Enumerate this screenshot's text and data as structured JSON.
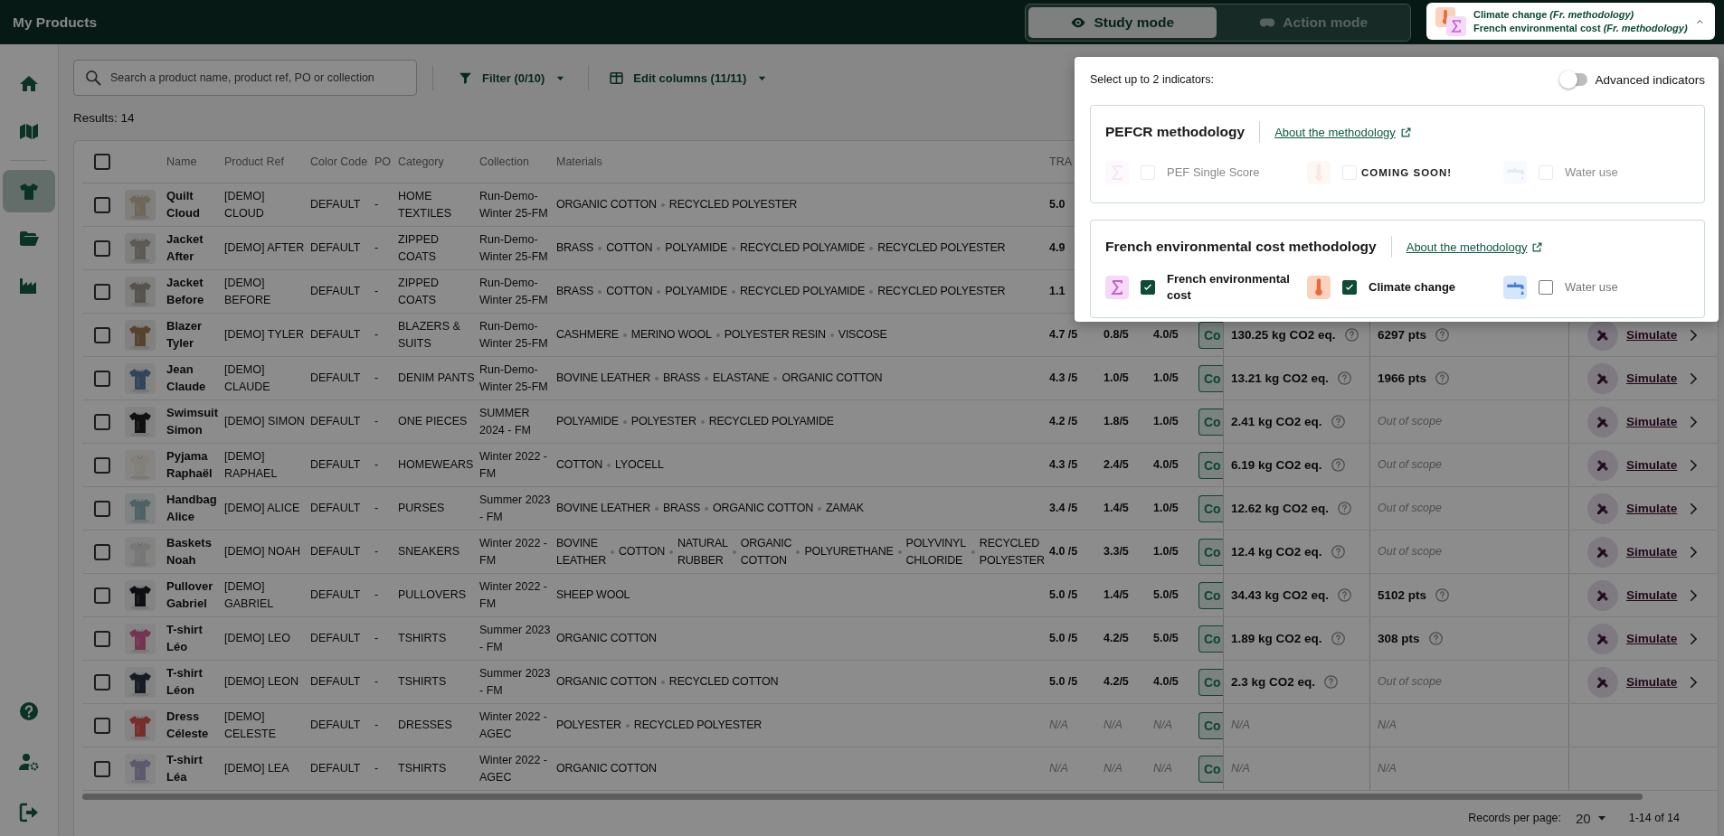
{
  "header": {
    "title": "My Products",
    "modes": [
      {
        "label": "Study mode",
        "selected": true
      },
      {
        "label": "Action mode",
        "selected": false
      }
    ]
  },
  "indicator_selector": {
    "expanded": true,
    "lines": [
      {
        "kind": "climate",
        "text": "Climate change *(Fr. methodology)*"
      },
      {
        "kind": "cost",
        "text": "French environmental cost *(Fr. methodology)*"
      }
    ]
  },
  "sidebar": {
    "items": [
      {
        "selected": false
      },
      {
        "selected": false
      },
      {
        "selected": true
      },
      {
        "selected": false
      },
      {
        "selected": false
      }
    ]
  },
  "toolbar": {
    "search": {
      "placeholder": "Search a product name, product ref, PO or collection"
    },
    "filter": "Filter (0/10)",
    "columns": "Edit columns (11/11)"
  },
  "results": "Results: 14",
  "table": {
    "header_checked": false,
    "columns": [
      "Name",
      "Product Ref",
      "Color Code",
      "PO",
      "Category",
      "Collection",
      "Materials",
      "TRA"
    ],
    "rows": [
      {
        "checked": false,
        "thumbnail": {
          "kind": "picture"
        },
        "name": "Quilt Cloud",
        "ref": "[DEMO] CLOUD",
        "color_code": "DEFAULT",
        "po": "-",
        "category": "HOME TEXTILES",
        "collection": "Run-Demo-Winter 25-FM",
        "materials": [
          "ORGANIC COTTON",
          "RECYCLED POLYESTER"
        ],
        "scores": [
          {
            "text": "5.0",
            "kind": "value"
          }
        ]
      },
      {
        "checked": false,
        "thumbnail": {
          "kind": "picture"
        },
        "name": "Jacket After",
        "ref": "[DEMO] AFTER",
        "color_code": "DEFAULT",
        "po": "-",
        "category": "ZIPPED COATS",
        "collection": "Run-Demo-Winter 25-FM",
        "materials": [
          "BRASS",
          "COTTON",
          "POLYAMIDE",
          "RECYCLED POLYAMIDE",
          "RECYCLED POLYESTER"
        ],
        "scores": [
          {
            "text": "4.9",
            "kind": "value"
          }
        ]
      },
      {
        "checked": false,
        "thumbnail": {
          "kind": "picture"
        },
        "name": "Jacket Before",
        "ref": "[DEMO] BEFORE",
        "color_code": "DEFAULT",
        "po": "-",
        "category": "ZIPPED COATS",
        "collection": "Run-Demo-Winter 25-FM",
        "materials": [
          "BRASS",
          "COTTON",
          "POLYAMIDE",
          "RECYCLED POLYAMIDE",
          "RECYCLED POLYESTER"
        ],
        "scores": [
          {
            "text": "1.1",
            "kind": "value"
          }
        ]
      },
      {
        "checked": false,
        "thumbnail": {
          "kind": "picture"
        },
        "name": "Blazer Tyler",
        "ref": "[DEMO] TYLER",
        "color_code": "DEFAULT",
        "po": "-",
        "category": "BLAZERS & SUITS",
        "collection": "Run-Demo-Winter 25-FM",
        "materials": [
          "CASHMERE",
          "MERINO WOOL",
          "POLYESTER RESIN",
          "VISCOSE"
        ],
        "scores": [
          {
            "text": "4.7 /5",
            "kind": "value"
          },
          {
            "text": "0.8/5",
            "kind": "value"
          },
          {
            "text": "4.0/5",
            "kind": "value"
          }
        ],
        "compare": "Co",
        "co2": {
          "text": "130.25 kg CO2 eq.",
          "kind": "value"
        },
        "points": {
          "text": "6297 pts",
          "kind": "value"
        },
        "action": "Simulate"
      },
      {
        "checked": false,
        "thumbnail": {
          "kind": "picture"
        },
        "name": "Jean Claude",
        "ref": "[DEMO] CLAUDE",
        "color_code": "DEFAULT",
        "po": "-",
        "category": "DENIM PANTS",
        "collection": "Run-Demo-Winter 25-FM",
        "materials": [
          "BOVINE LEATHER",
          "BRASS",
          "ELASTANE",
          "ORGANIC COTTON"
        ],
        "scores": [
          {
            "text": "4.3 /5",
            "kind": "value"
          },
          {
            "text": "1.0/5",
            "kind": "value"
          },
          {
            "text": "1.0/5",
            "kind": "value"
          }
        ],
        "compare": "Co",
        "co2": {
          "text": "13.21 kg CO2 eq.",
          "kind": "value"
        },
        "points": {
          "text": "1966 pts",
          "kind": "value"
        },
        "action": "Simulate"
      },
      {
        "checked": false,
        "thumbnail": {
          "kind": "picture"
        },
        "name": "Swimsuit Simon",
        "ref": "[DEMO] SIMON",
        "color_code": "DEFAULT",
        "po": "-",
        "category": "ONE PIECES",
        "collection": "SUMMER 2024 - FM",
        "materials": [
          "POLYAMIDE",
          "POLYESTER",
          "RECYCLED POLYAMIDE"
        ],
        "scores": [
          {
            "text": "4.2 /5",
            "kind": "value"
          },
          {
            "text": "1.8/5",
            "kind": "value"
          },
          {
            "text": "1.0/5",
            "kind": "value"
          }
        ],
        "compare": "Co",
        "co2": {
          "text": "2.41 kg CO2 eq.",
          "kind": "value"
        },
        "points": {
          "text": "Out of scope",
          "kind": "out"
        },
        "action": "Simulate"
      },
      {
        "checked": false,
        "thumbnail": {
          "kind": "picture"
        },
        "name": "Pyjama Raphaël",
        "ref": "[DEMO] RAPHAEL",
        "color_code": "DEFAULT",
        "po": "-",
        "category": "HOMEWEARS",
        "collection": "Winter 2022 - FM",
        "materials": [
          "COTTON",
          "LYOCELL"
        ],
        "scores": [
          {
            "text": "4.3 /5",
            "kind": "value"
          },
          {
            "text": "2.4/5",
            "kind": "value"
          },
          {
            "text": "4.0/5",
            "kind": "value"
          }
        ],
        "compare": "Co",
        "co2": {
          "text": "6.19 kg CO2 eq.",
          "kind": "value"
        },
        "points": {
          "text": "Out of scope",
          "kind": "out"
        },
        "action": "Simulate"
      },
      {
        "checked": false,
        "thumbnail": {
          "kind": "picture"
        },
        "name": "Handbag Alice",
        "ref": "[DEMO] ALICE",
        "color_code": "DEFAULT",
        "po": "-",
        "category": "PURSES",
        "collection": "Summer 2023 - FM",
        "materials": [
          "BOVINE LEATHER",
          "BRASS",
          "ORGANIC COTTON",
          "ZAMAK"
        ],
        "scores": [
          {
            "text": "3.4 /5",
            "kind": "value"
          },
          {
            "text": "1.4/5",
            "kind": "value"
          },
          {
            "text": "1.0/5",
            "kind": "value"
          }
        ],
        "compare": "Co",
        "co2": {
          "text": "12.62 kg CO2 eq.",
          "kind": "value"
        },
        "points": {
          "text": "Out of scope",
          "kind": "out"
        },
        "action": "Simulate"
      },
      {
        "checked": false,
        "thumbnail": {
          "kind": "picture"
        },
        "name": "Baskets Noah",
        "ref": "[DEMO] NOAH",
        "color_code": "DEFAULT",
        "po": "-",
        "category": "SNEAKERS",
        "collection": "Winter 2022 - FM",
        "materials": [
          "BOVINE LEATHER",
          "COTTON",
          "NATURAL RUBBER",
          "ORGANIC COTTON",
          "POLYURETHANE",
          "POLYVINYL CHLORIDE",
          "RECYCLED POLYESTER"
        ],
        "scores": [
          {
            "text": "4.0 /5",
            "kind": "value"
          },
          {
            "text": "3.3/5",
            "kind": "value"
          },
          {
            "text": "1.0/5",
            "kind": "value"
          }
        ],
        "compare": "Co",
        "co2": {
          "text": "12.4 kg CO2 eq.",
          "kind": "value"
        },
        "points": {
          "text": "Out of scope",
          "kind": "out"
        },
        "action": "Simulate"
      },
      {
        "checked": false,
        "thumbnail": {
          "kind": "picture"
        },
        "name": "Pullover Gabriel",
        "ref": "[DEMO] GABRIEL",
        "color_code": "DEFAULT",
        "po": "-",
        "category": "PULLOVERS",
        "collection": "Winter 2022 - FM",
        "materials": [
          "SHEEP WOOL"
        ],
        "scores": [
          {
            "text": "5.0 /5",
            "kind": "value"
          },
          {
            "text": "1.4/5",
            "kind": "value"
          },
          {
            "text": "5.0/5",
            "kind": "value"
          }
        ],
        "compare": "Co",
        "co2": {
          "text": "34.43 kg CO2 eq.",
          "kind": "value"
        },
        "points": {
          "text": "5102 pts",
          "kind": "value"
        },
        "action": "Simulate"
      },
      {
        "checked": false,
        "thumbnail": {
          "kind": "picture"
        },
        "name": "T-shirt Léo",
        "ref": "[DEMO] LEO",
        "color_code": "DEFAULT",
        "po": "-",
        "category": "TSHIRTS",
        "collection": "Summer 2023 - FM",
        "materials": [
          "ORGANIC COTTON"
        ],
        "scores": [
          {
            "text": "5.0 /5",
            "kind": "value"
          },
          {
            "text": "4.2/5",
            "kind": "value"
          },
          {
            "text": "5.0/5",
            "kind": "value"
          }
        ],
        "compare": "Co",
        "co2": {
          "text": "1.89 kg CO2 eq.",
          "kind": "value"
        },
        "points": {
          "text": "308 pts",
          "kind": "value"
        },
        "action": "Simulate"
      },
      {
        "checked": false,
        "thumbnail": {
          "kind": "picture"
        },
        "name": "T-shirt Léon",
        "ref": "[DEMO] LEON",
        "color_code": "DEFAULT",
        "po": "-",
        "category": "TSHIRTS",
        "collection": "Summer 2023 - FM",
        "materials": [
          "ORGANIC COTTON",
          "RECYCLED COTTON"
        ],
        "scores": [
          {
            "text": "5.0 /5",
            "kind": "value"
          },
          {
            "text": "4.2/5",
            "kind": "value"
          },
          {
            "text": "4.0/5",
            "kind": "value"
          }
        ],
        "compare": "Co",
        "co2": {
          "text": "2.3 kg CO2 eq.",
          "kind": "value"
        },
        "points": {
          "text": "Out of scope",
          "kind": "out"
        },
        "action": "Simulate"
      },
      {
        "checked": false,
        "thumbnail": {
          "kind": "picture"
        },
        "name": "Dress Céleste",
        "ref": "[DEMO] CELESTE",
        "color_code": "DEFAULT",
        "po": "-",
        "category": "DRESSES",
        "collection": "Winter 2022 - AGEC",
        "materials": [
          "POLYESTER",
          "RECYCLED POLYESTER"
        ],
        "scores": [
          {
            "text": "N/A",
            "kind": "na"
          },
          {
            "text": "N/A",
            "kind": "na"
          },
          {
            "text": "N/A",
            "kind": "na"
          }
        ],
        "compare": "Co",
        "co2": {
          "text": "N/A",
          "kind": "na"
        },
        "points": {
          "text": "N/A",
          "kind": "na"
        }
      },
      {
        "checked": false,
        "thumbnail": {
          "kind": "picture"
        },
        "name": "T-shirt Léa",
        "ref": "[DEMO] LEA",
        "color_code": "DEFAULT",
        "po": "-",
        "category": "TSHIRTS",
        "collection": "Winter 2022 - AGEC",
        "materials": [
          "ORGANIC COTTON"
        ],
        "scores": [
          {
            "text": "N/A",
            "kind": "na"
          },
          {
            "text": "N/A",
            "kind": "na"
          },
          {
            "text": "N/A",
            "kind": "na"
          }
        ],
        "compare": "Co",
        "co2": {
          "text": "N/A",
          "kind": "na"
        },
        "points": {
          "text": "N/A",
          "kind": "na"
        }
      }
    ]
  },
  "pagination": {
    "label": "Records per page:",
    "per_page": "20",
    "range": "1-14 of 14"
  },
  "indicator_popup": {
    "prompt": "Select up to 2 indicators:",
    "advanced": {
      "label": "Advanced indicators",
      "on": false
    },
    "sections": [
      {
        "title": "PEFCR methodology",
        "link": "About the methodology",
        "notice": "COMING SOON!",
        "items": [
          {
            "kind": "cost",
            "label": "PEF Single Score",
            "checked": false,
            "disabled": true
          },
          {
            "kind": "climate",
            "checked": false,
            "disabled": true
          },
          {
            "kind": "water",
            "label": "Water use",
            "checked": false,
            "disabled": true
          }
        ]
      },
      {
        "title": "French environmental cost methodology",
        "link": "About the methodology",
        "items": [
          {
            "kind": "cost",
            "label": "French environmental cost",
            "checked": true,
            "disabled": false
          },
          {
            "kind": "climate",
            "label": "Climate change",
            "checked": true,
            "disabled": false
          },
          {
            "kind": "water",
            "label": "Water use",
            "checked": false,
            "disabled": false
          }
        ]
      }
    ]
  }
}
